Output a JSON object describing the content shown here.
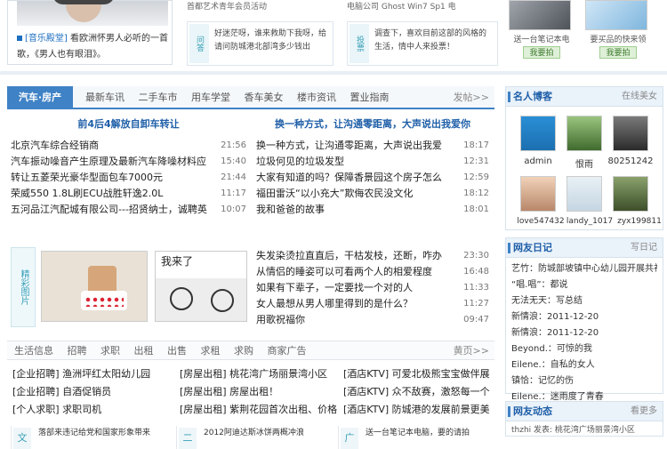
{
  "top": {
    "music_tag": "[音乐殿堂]",
    "music_text": "看欧洲怀男人必听的一首歌，《男人也有眼泪》。",
    "snippet1": "首都艺术青年会员活动",
    "snippet2": "电脑公司 Ghost Win7 Sp1 电",
    "ask_tag": "问答",
    "ask_text": "好迷茫呀，谁来救助下我呀，给请问防城港北部湾多少钱出",
    "vote_tag": "投票",
    "vote_text": "调查下，喜欢目前这部的风格的生活，情中人来投票！",
    "gift1_caption": "送一台笔记本电",
    "gift1_button": "我要拍",
    "gift2_caption": "要买品的快来领",
    "gift2_button": "我要拍"
  },
  "main": {
    "active_tab": "汽车·房产",
    "tabs": [
      "最新车讯",
      "二手车市",
      "用车学堂",
      "香车美女",
      "楼市资讯",
      "置业指南"
    ],
    "more": "发帖>>",
    "col1_title": "前4后4解放自卸车转让",
    "col1_items": [
      {
        "text": "北京汽车综合经销商",
        "date": "21:56"
      },
      {
        "text": "汽车振动噪音产生原理及最新汽车降噪材料应",
        "date": "15:40"
      },
      {
        "text": "转让五菱荣光豪华型面包车7000元",
        "date": "21:44"
      },
      {
        "text": "荣威550 1.8L刷ECU战胜轩逸2.0L",
        "date": "11:17"
      },
      {
        "text": "五河品江汽配城有限公司---招贤纳士，诚聘英",
        "date": "10:07"
      }
    ],
    "col2_title": "换一种方式，让沟通零距离，大声说出我爱你",
    "col2_items": [
      {
        "text": "换一种方式，让沟通零距离，大声说出我爱",
        "date": "18:17"
      },
      {
        "text": "垃圾何见的垃圾发型",
        "date": "12:31"
      },
      {
        "text": "大家有知道的吗？保障香景园这个房子怎么",
        "date": "12:59"
      },
      {
        "text": "福田雷沃“以小充大”欺侮农民没文化",
        "date": "18:12"
      },
      {
        "text": "我和爸爸的故事",
        "date": "18:01"
      }
    ],
    "photo_tag": "精彩图片",
    "photo2_text": "我来了",
    "col2b_items": [
      {
        "text": "失发染烫拉直直后，干枯发枝，还断，咋办",
        "date": "23:30"
      },
      {
        "text": "从情侣的睡姿可以可看两个人的相爱程度",
        "date": "16:48"
      },
      {
        "text": "如果有下辈子，一定要找一个对的人",
        "date": "11:33"
      },
      {
        "text": "女人最想从男人哪里得到的是什么？",
        "date": "11:27"
      },
      {
        "text": "用歌祝福你",
        "date": "09:47"
      }
    ],
    "tabs2": [
      "生活信息",
      "招聘",
      "求职",
      "出租",
      "出售",
      "求租",
      "求购",
      "商家广告"
    ],
    "tabs2_more": "黄页>>",
    "classifieds": [
      [
        "[企业招聘] 渔洲坪红太阳幼儿园",
        "[房屋出租] 桃花湾广场丽景湾小区",
        "[酒店KTV] 可爱北极熊宝宝做伴展"
      ],
      [
        "[企业招聘] 自酒促销员",
        "[房屋出租] 房屋出租！",
        "[酒店KTV] 众不敌赛，激怒每一个"
      ],
      [
        "[个人求职] 求职司机",
        "[房屋出租] 紫荆花园首次出租、价格",
        "[酒店KTV] 防城港的发展前景更美"
      ]
    ],
    "bottom": [
      {
        "tag": "文",
        "text": "落部来违记给党和国家形象带来"
      },
      {
        "tag": "二",
        "text": "2012阿迪达斯冰饼两概冲浪"
      },
      {
        "tag": "广",
        "text": "送一台笔记本电脑，要的请拍"
      }
    ]
  },
  "side": {
    "celebs_title": "名人博客",
    "celebs_more": "在线美女",
    "celebs": [
      "admin",
      "恨雨",
      "80251242",
      "love547432",
      "landy_1017",
      "zyx199811"
    ],
    "diary_title": "网友日记",
    "diary_more": "写日记",
    "diary": [
      "艺竹：防城部坡镇中心幼儿园开展共礼",
      "“唱.唱”：都说",
      "无法无天：写总结",
      "新情浪：2011-12-20",
      "新情浪：2011-12-20",
      "Beyond.：可惊的我",
      "Eilene.：自私的女人",
      "镇恰：记忆的伤",
      "Eilene.：迷雨度了青春"
    ],
    "activity_title": "网友动态",
    "activity_more": "看更多",
    "activity_text": "thzhi 发表: 桃花湾广场丽景湾小区"
  }
}
